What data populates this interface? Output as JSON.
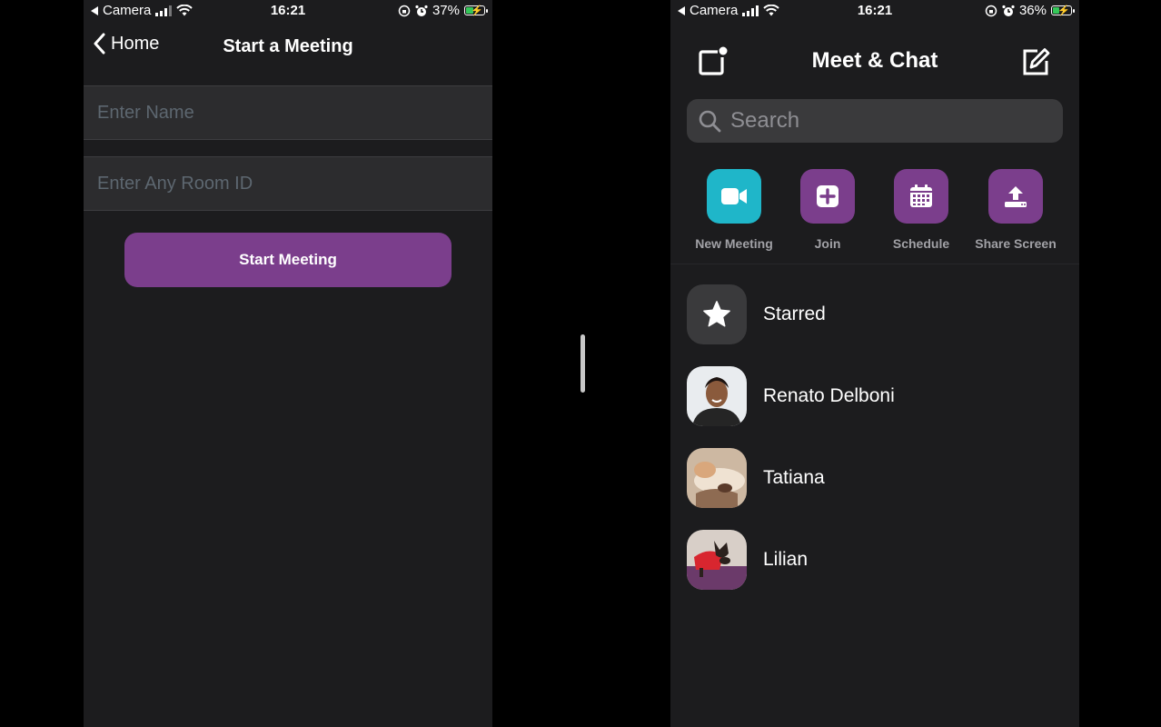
{
  "left": {
    "status": {
      "back_app": "Camera",
      "time": "16:21",
      "battery": "37%"
    },
    "nav": {
      "back_label": "Home",
      "title": "Start a Meeting"
    },
    "form": {
      "name_placeholder": "Enter Name",
      "room_placeholder": "Enter Any Room ID",
      "start_label": "Start Meeting"
    }
  },
  "right": {
    "status": {
      "back_app": "Camera",
      "time": "16:21",
      "battery": "36%"
    },
    "header": {
      "title": "Meet & Chat"
    },
    "search": {
      "placeholder": "Search"
    },
    "actions": [
      {
        "label": "New Meeting",
        "icon": "video-camera-icon",
        "color": "#1fb6c9"
      },
      {
        "label": "Join",
        "icon": "plus-square-icon",
        "color": "#7b3e8c"
      },
      {
        "label": "Schedule",
        "icon": "calendar-icon",
        "color": "#7b3e8c"
      },
      {
        "label": "Share Screen",
        "icon": "upload-tray-icon",
        "color": "#7b3e8c"
      }
    ],
    "contacts": [
      {
        "name": "Starred",
        "icon": "star-icon"
      },
      {
        "name": "Renato Delboni"
      },
      {
        "name": "Tatiana"
      },
      {
        "name": "Lilian"
      }
    ]
  },
  "colors": {
    "accent_purple": "#7b3e8c",
    "accent_teal": "#1fb6c9",
    "background": "#1c1c1e"
  }
}
